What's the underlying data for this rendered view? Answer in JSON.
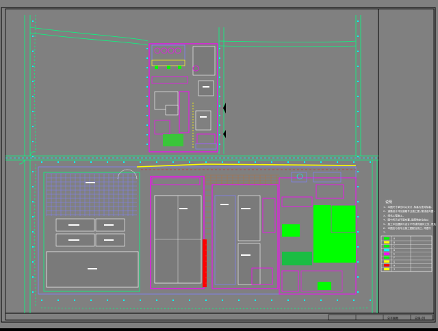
{
  "colors": {
    "background": "#808080",
    "road_green": "#00ff7f",
    "boundary_magenta": "#ff00ff",
    "building_blue": "#8080ff",
    "cyan": "#00ffff",
    "yellow": "#ffff00",
    "red": "#ff0000",
    "green_fill": "#00ff00",
    "white_line": "#ffffff"
  },
  "notes": {
    "heading": "说明",
    "lines": [
      "1. 本图尺寸单位均以米计,标高为绝对标高.",
      "2. 道路设计详见道路专业施工图,管线走向图.",
      "3. 绿化工程施工,",
      "4. 图中所示总平面布置,建筑物定位应以",
      "5. 施工中如遇到与设计不符或有疑问之处,须及",
      "6. 本图应与各专业施工图配合施工,并遵守",
      "7."
    ]
  },
  "legend": {
    "rows": [
      {
        "symbol": "A",
        "color": "#00ff00"
      },
      {
        "symbol": "B",
        "color": "#ffff00"
      },
      {
        "symbol": "C",
        "color": "#00ff00"
      },
      {
        "symbol": "D",
        "color": "#00ffff"
      },
      {
        "symbol": "E",
        "color": "#ff00ff"
      },
      {
        "symbol": "F",
        "color": "#00ff00"
      },
      {
        "symbol": "G",
        "color": "#ffff00"
      },
      {
        "symbol": "H",
        "color": "#ff0000"
      },
      {
        "symbol": "I",
        "color": "#ffff00"
      }
    ]
  },
  "title_block": {
    "drawing_label": "总平面图",
    "sheet_no": "总施-01"
  }
}
